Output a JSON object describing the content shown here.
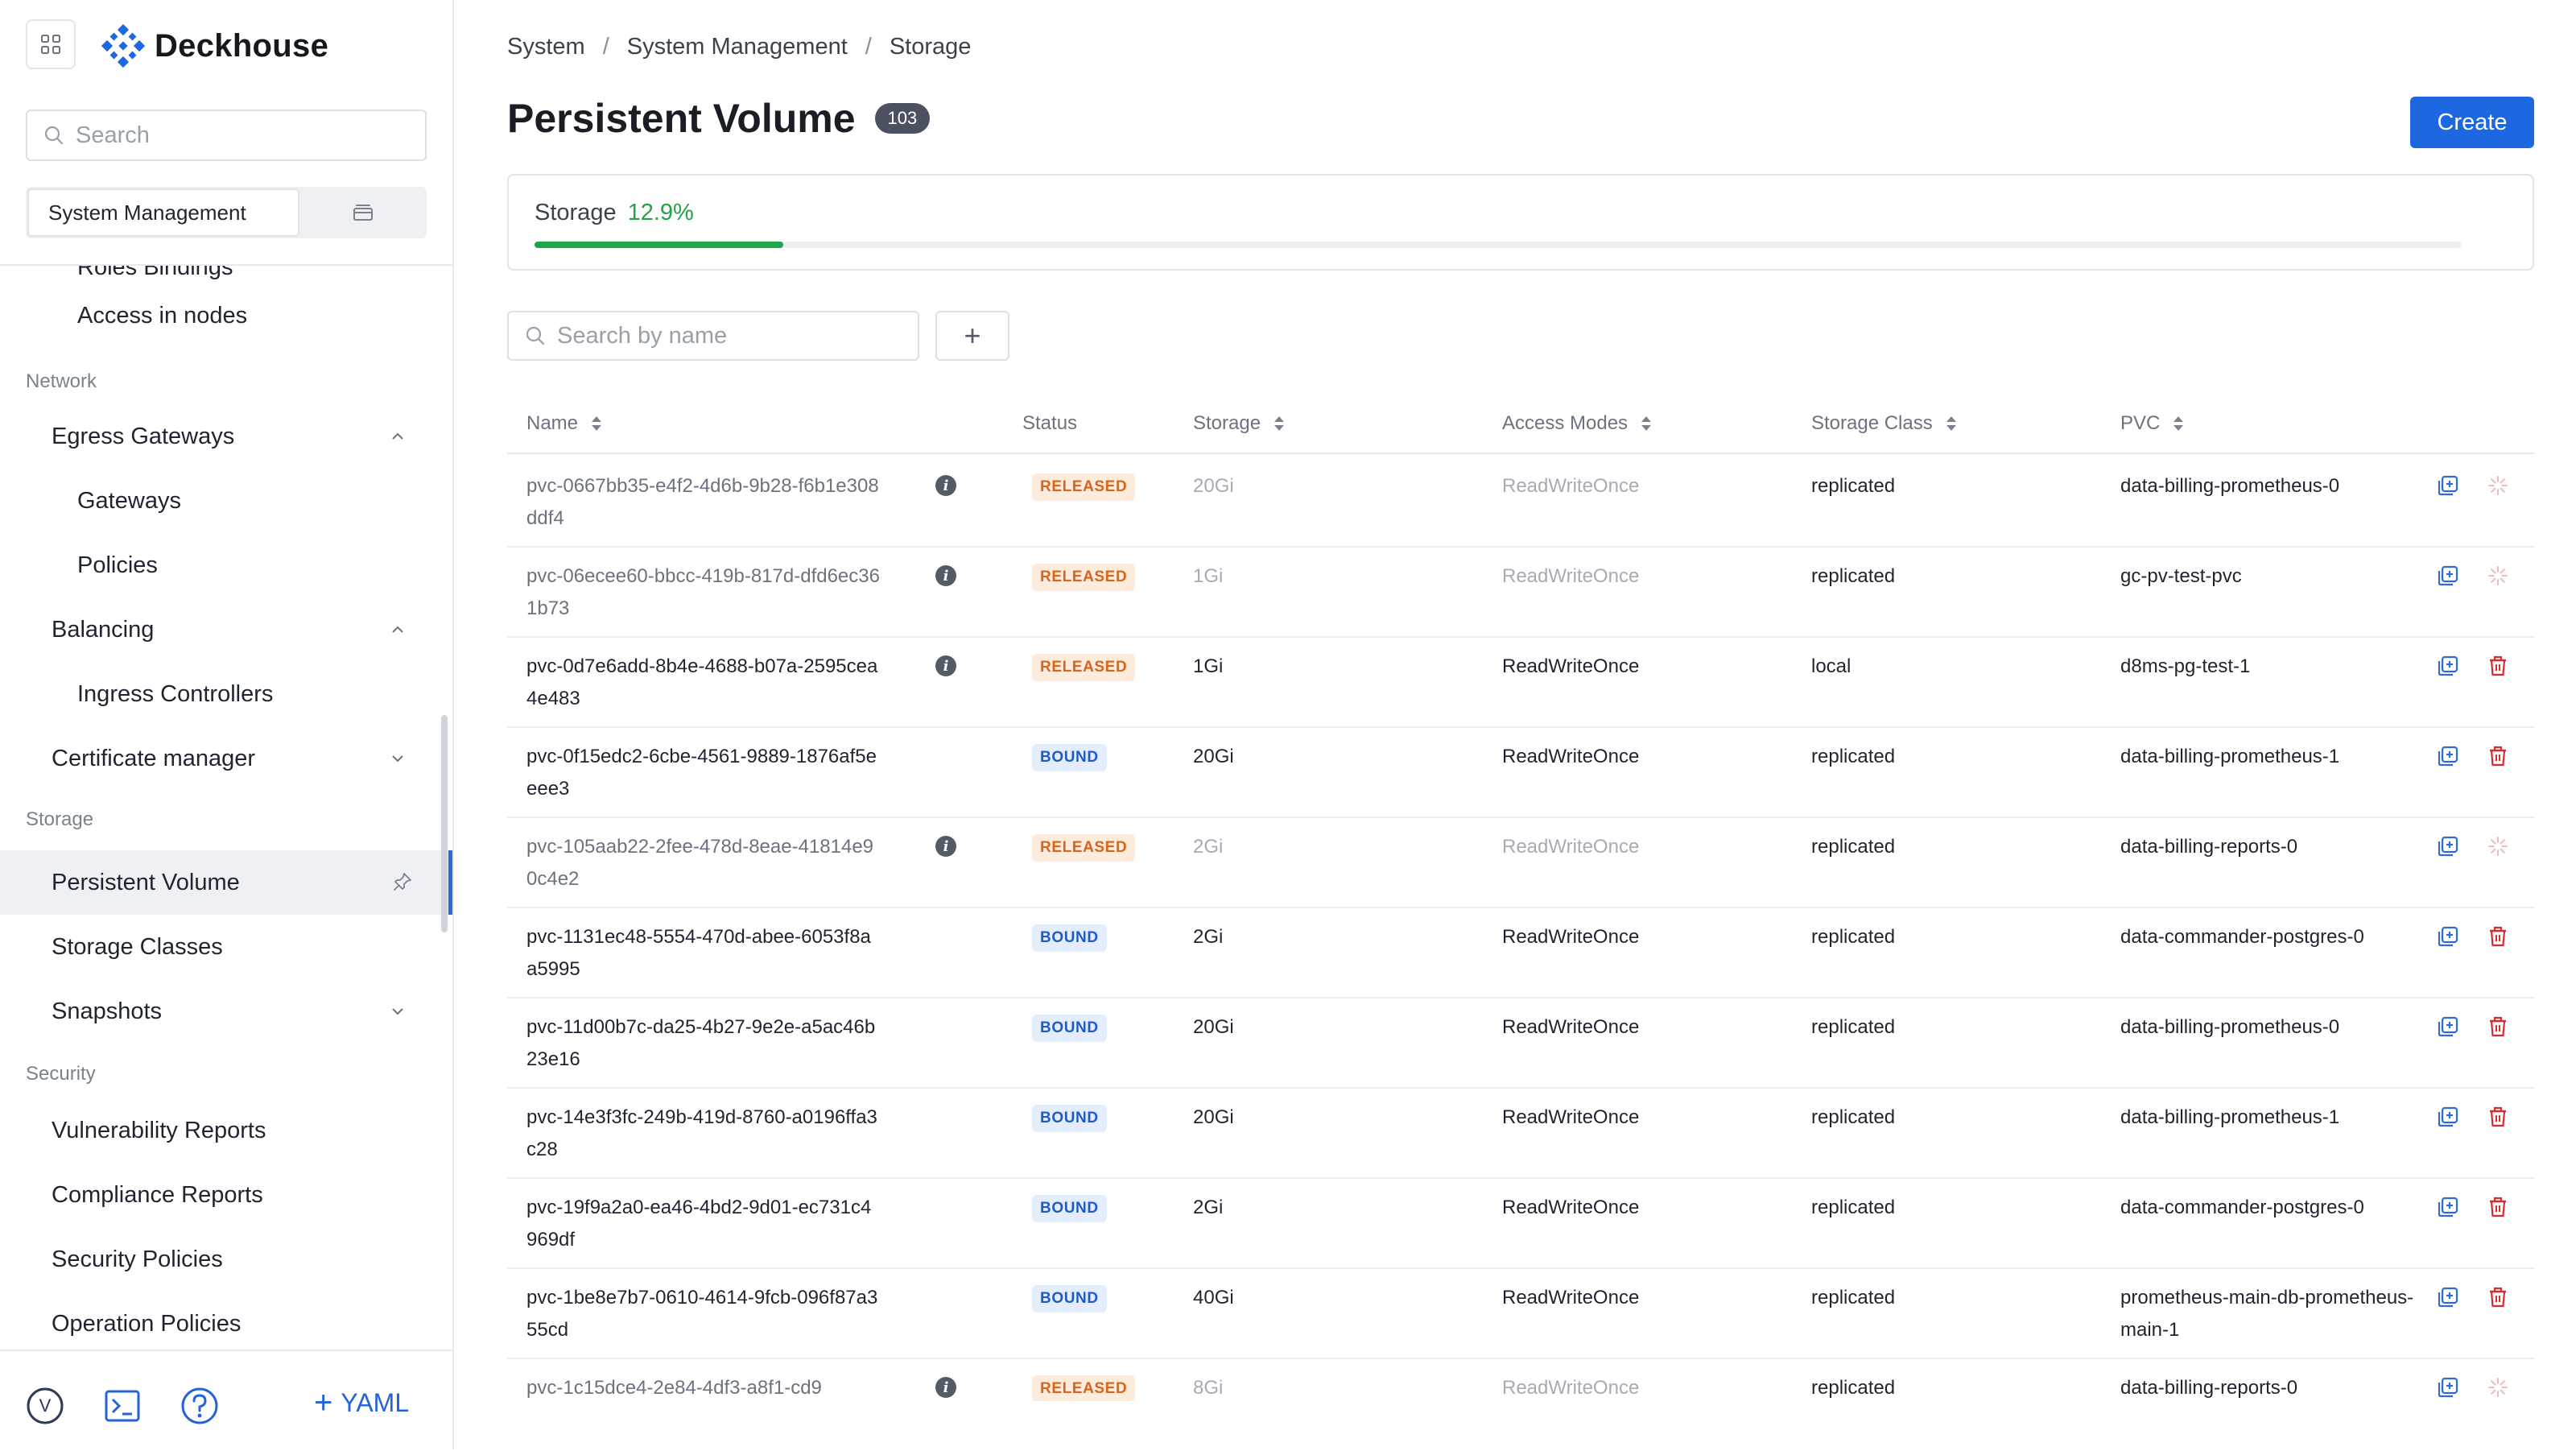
{
  "app": {
    "brand": "Deckhouse",
    "search_placeholder": "Search",
    "segment_active": "System Management"
  },
  "sidebar": {
    "items": [
      {
        "key": "roles",
        "label": "Roles Bindings",
        "level": 2
      },
      {
        "key": "access",
        "label": "Access in nodes",
        "level": 2
      },
      {
        "key": "section-network",
        "label": "Network",
        "section": true
      },
      {
        "key": "egress",
        "label": "Egress Gateways",
        "level": 1,
        "chevron": "up"
      },
      {
        "key": "gateways",
        "label": "Gateways",
        "level": 2
      },
      {
        "key": "policies",
        "label": "Policies",
        "level": 2
      },
      {
        "key": "balancing",
        "label": "Balancing",
        "level": 1,
        "chevron": "up"
      },
      {
        "key": "ingress",
        "label": "Ingress Controllers",
        "level": 2
      },
      {
        "key": "certs",
        "label": "Certificate manager",
        "level": 1,
        "chevron": "down"
      },
      {
        "key": "section-storage",
        "label": "Storage",
        "section": true
      },
      {
        "key": "pv",
        "label": "Persistent Volume",
        "level": 1,
        "active": true
      },
      {
        "key": "sc",
        "label": "Storage Classes",
        "level": 1
      },
      {
        "key": "snapshots",
        "label": "Snapshots",
        "level": 1,
        "chevron": "down"
      },
      {
        "key": "section-security",
        "label": "Security",
        "section": true
      },
      {
        "key": "vuln",
        "label": "Vulnerability Reports",
        "level": 1
      },
      {
        "key": "compliance",
        "label": "Compliance Reports",
        "level": 1
      },
      {
        "key": "secpol",
        "label": "Security Policies",
        "level": 1
      },
      {
        "key": "oppol",
        "label": "Operation Policies",
        "level": 1
      }
    ],
    "footer": {
      "avatar_letter": "V",
      "yaml_label": "YAML"
    }
  },
  "breadcrumb": [
    "System",
    "System Management",
    "Storage"
  ],
  "page": {
    "title": "Persistent Volume",
    "count": "103",
    "create_label": "Create"
  },
  "storage": {
    "label": "Storage",
    "percent_text": "12.9%",
    "fraction": 0.129
  },
  "table": {
    "search_placeholder": "Search by name",
    "columns": {
      "name": "Name",
      "status": "Status",
      "storage": "Storage",
      "access": "Access Modes",
      "class": "Storage Class",
      "pvc": "PVC"
    },
    "rows": [
      {
        "name": "pvc-0667bb35-e4f2-4d6b-9b28-f6b1e308ddf4",
        "info": true,
        "status": "RELEASED",
        "storage": "20Gi",
        "access": "ReadWriteOnce",
        "class": "replicated",
        "pvc": "data-billing-prometheus-0",
        "muted": true
      },
      {
        "name": "pvc-06ecee60-bbcc-419b-817d-dfd6ec361b73",
        "info": true,
        "status": "RELEASED",
        "storage": "1Gi",
        "access": "ReadWriteOnce",
        "class": "replicated",
        "pvc": "gc-pv-test-pvc",
        "muted": true
      },
      {
        "name": "pvc-0d7e6add-8b4e-4688-b07a-2595cea4e483",
        "info": true,
        "status": "RELEASED",
        "storage": "1Gi",
        "access": "ReadWriteOnce",
        "class": "local",
        "pvc": "d8ms-pg-test-1",
        "muted": false
      },
      {
        "name": "pvc-0f15edc2-6cbe-4561-9889-1876af5eeee3",
        "info": false,
        "status": "BOUND",
        "storage": "20Gi",
        "access": "ReadWriteOnce",
        "class": "replicated",
        "pvc": "data-billing-prometheus-1",
        "muted": false
      },
      {
        "name": "pvc-105aab22-2fee-478d-8eae-41814e90c4e2",
        "info": true,
        "status": "RELEASED",
        "storage": "2Gi",
        "access": "ReadWriteOnce",
        "class": "replicated",
        "pvc": "data-billing-reports-0",
        "muted": true
      },
      {
        "name": "pvc-1131ec48-5554-470d-abee-6053f8aa5995",
        "info": false,
        "status": "BOUND",
        "storage": "2Gi",
        "access": "ReadWriteOnce",
        "class": "replicated",
        "pvc": "data-commander-postgres-0",
        "muted": false
      },
      {
        "name": "pvc-11d00b7c-da25-4b27-9e2e-a5ac46b23e16",
        "info": false,
        "status": "BOUND",
        "storage": "20Gi",
        "access": "ReadWriteOnce",
        "class": "replicated",
        "pvc": "data-billing-prometheus-0",
        "muted": false
      },
      {
        "name": "pvc-14e3f3fc-249b-419d-8760-a0196ffa3c28",
        "info": false,
        "status": "BOUND",
        "storage": "20Gi",
        "access": "ReadWriteOnce",
        "class": "replicated",
        "pvc": "data-billing-prometheus-1",
        "muted": false
      },
      {
        "name": "pvc-19f9a2a0-ea46-4bd2-9d01-ec731c4969df",
        "info": false,
        "status": "BOUND",
        "storage": "2Gi",
        "access": "ReadWriteOnce",
        "class": "replicated",
        "pvc": "data-commander-postgres-0",
        "muted": false
      },
      {
        "name": "pvc-1be8e7b7-0610-4614-9fcb-096f87a355cd",
        "info": false,
        "status": "BOUND",
        "storage": "40Gi",
        "access": "ReadWriteOnce",
        "class": "replicated",
        "pvc": "prometheus-main-db-prometheus-main-1",
        "muted": false
      },
      {
        "name": "pvc-1c15dce4-2e84-4df3-a8f1-cd9",
        "info": true,
        "status": "RELEASED",
        "storage": "8Gi",
        "access": "ReadWriteOnce",
        "class": "replicated",
        "pvc": "data-billing-reports-0",
        "muted": true
      }
    ]
  },
  "colors": {
    "accent": "#1d68e0",
    "progress": "#21a54a",
    "released_text": "#d9641a",
    "bound_text": "#1d5bc9",
    "delete_icon": "#d92d2d",
    "delete_disabled": "#f4b9b9"
  },
  "icons": {
    "apps": "grid-icon",
    "logo": "deckhouse-logo-icon",
    "search": "search-icon",
    "segment_alt": "layers-icon",
    "pin": "pin-icon",
    "terminal": "terminal-icon",
    "help": "help-icon",
    "edit": "edit-icon",
    "delete": "trash-icon"
  }
}
